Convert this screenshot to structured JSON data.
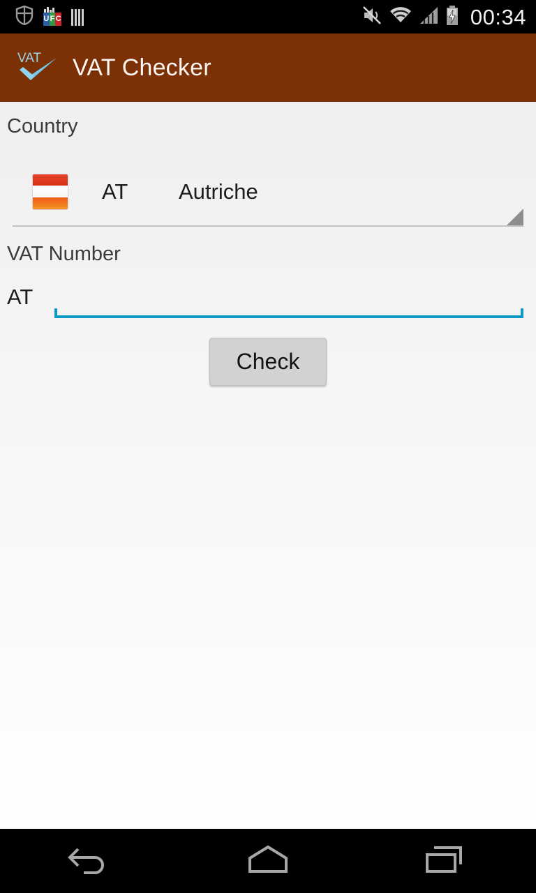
{
  "status_bar": {
    "clock": "00:34",
    "left_icons": [
      {
        "name": "shield-icon",
        "label": "shield"
      },
      {
        "name": "ufc-icon",
        "label": "UFC",
        "letters": [
          "U",
          "F",
          "C"
        ]
      },
      {
        "name": "barcode-icon",
        "label": "barcode"
      }
    ],
    "right_icons": [
      {
        "name": "mute-icon",
        "label": "ringer-muted"
      },
      {
        "name": "wifi-icon",
        "label": "wifi"
      },
      {
        "name": "cell-signal-icon",
        "label": "signal"
      },
      {
        "name": "battery-charging-icon",
        "label": "battery-charging"
      }
    ]
  },
  "app_bar": {
    "title": "VAT Checker",
    "icon_name": "vat-check-icon",
    "icon_text": "VAT",
    "background_color": "#7c3005",
    "title_color": "#fdf6f2"
  },
  "form": {
    "country_label": "Country",
    "country": {
      "code": "AT",
      "name": "Autriche",
      "flag_name": "flag-austria-icon"
    },
    "vat_label": "VAT Number",
    "vat_prefix": "AT",
    "vat_value": "",
    "vat_placeholder": "",
    "accent_color": "#0d9ac4",
    "check_label": "Check"
  },
  "nav_bar": {
    "back_label": "Back",
    "home_label": "Home",
    "recents_label": "Recent apps"
  }
}
